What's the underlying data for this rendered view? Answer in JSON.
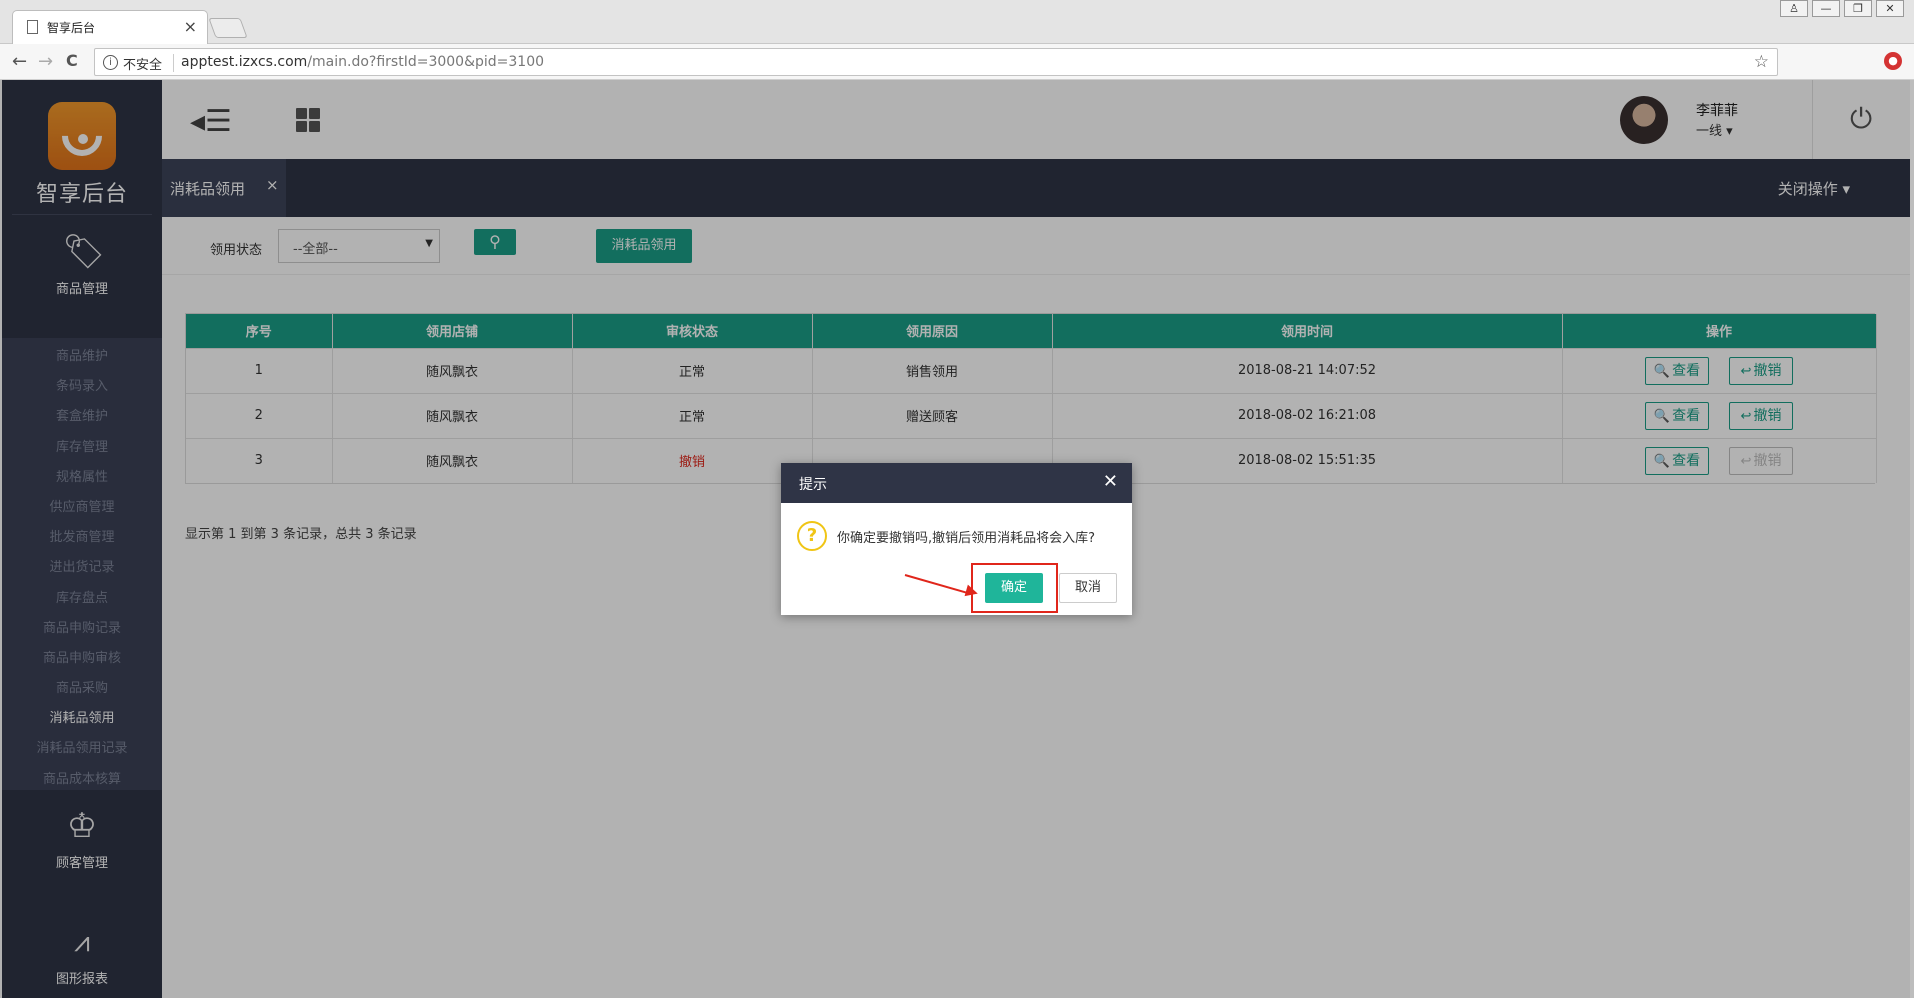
{
  "browser": {
    "tab_title": "智享后台",
    "tab_close": "×",
    "insecure_label": "不安全",
    "url_host": "apptest.izxcs.com",
    "url_path": "/main.do?firstId=3000&pid=3100",
    "back": "←",
    "forward": "→",
    "reload": "C",
    "star": "☆",
    "window_controls": [
      "♙",
      "—",
      "❐",
      "✕"
    ]
  },
  "sidebar": {
    "logo_text": "智享后台",
    "sections": [
      {
        "label": "商品管理",
        "icon": "price-tag-icon"
      },
      {
        "label": "顾客管理",
        "icon": "crown-icon"
      },
      {
        "label": "图形报表",
        "icon": "line-chart-icon"
      }
    ],
    "submenu": [
      "商品维护",
      "条码录入",
      "套盒维护",
      "库存管理",
      "规格属性",
      "供应商管理",
      "批发商管理",
      "进出货记录",
      "库存盘点",
      "商品申购记录",
      "商品申购审核",
      "商品采购",
      "消耗品领用",
      "消耗品领用记录",
      "商品成本核算"
    ],
    "active_item": "消耗品领用"
  },
  "topbar": {
    "user_name": "李菲菲",
    "user_role": "一线 ▾"
  },
  "tabs": {
    "open_tab": "消耗品领用",
    "close_symbol": "×",
    "close_ops": "关闭操作 ▾"
  },
  "filter": {
    "status_label": "领用状态",
    "status_value": "--全部--",
    "primary_button": "消耗品领用"
  },
  "table": {
    "headers": [
      "序号",
      "领用店铺",
      "审核状态",
      "领用原因",
      "领用时间",
      "操作"
    ],
    "rows": [
      {
        "no": "1",
        "shop": "随风飘衣",
        "status": "正常",
        "reason": "销售领用",
        "time": "2018-08-21 14:07:52"
      },
      {
        "no": "2",
        "shop": "随风飘衣",
        "status": "正常",
        "reason": "赠送顾客",
        "time": "2018-08-02 16:21:08"
      },
      {
        "no": "3",
        "shop": "随风飘衣",
        "status": "撤销",
        "reason": "",
        "time": "2018-08-02 15:51:35"
      }
    ],
    "view_label": "查看",
    "revoke_label": "撤销"
  },
  "pager": {
    "summary": "显示第 1 到第 3 条记录，总共 3 条记录"
  },
  "dialog": {
    "title": "提示",
    "close": "✕",
    "question_mark": "?",
    "message": "你确定要撤销吗,撤销后领用消耗品将会入库?",
    "ok": "确定",
    "cancel": "取消"
  },
  "colors": {
    "sidebar_bg": "#2f3446",
    "accent_teal": "#1b9e87",
    "danger_red": "#e0261b",
    "warning_yellow": "#f0c515"
  }
}
